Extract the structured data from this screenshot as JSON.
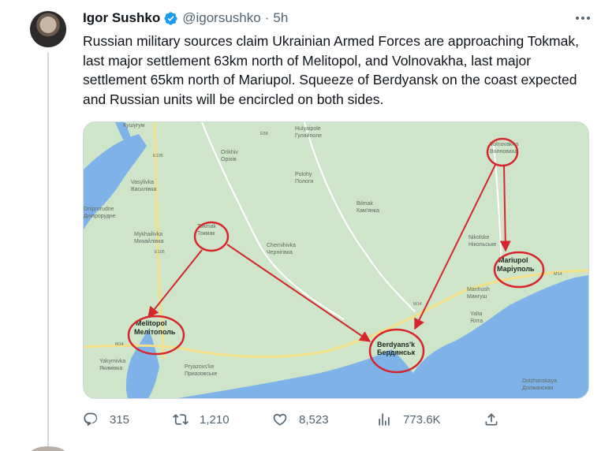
{
  "author": {
    "name": "Igor Sushko",
    "handle": "@igorsushko",
    "separator": "·",
    "time": "5h"
  },
  "tweet_text": "Russian military sources claim Ukrainian Armed Forces are approaching Tokmak, last major settlement 63km north of Melitopol, and Volnovakha, last major settlement 65km north of Mariupol. Squeeze of Berdyansk on the coast expected and Russian units will be encircled on both sides.",
  "map": {
    "places": {
      "kushuhum": "Кушугум",
      "hulyaipole_en": "Hulyaipole",
      "hulyaipole_ua": "Гуляйполе",
      "orikhiv_en": "Orikhiv",
      "orikhiv_ua": "Оріхів",
      "polohy_en": "Polohy",
      "polohy_ua": "Пологи",
      "vasylivka_en": "Vasylivka",
      "vasylivka_ua": "Василівка",
      "dniprorudne_en": "Dniprorudne",
      "dniprorudne_ua": "Дніпрорудне",
      "bilmak_en": "Bilmak",
      "bilmak_ua": "Кам'янка",
      "mykhailivka_en": "Mykhailivka",
      "mykhailivka_ua": "Михайлівка",
      "tokmak_en": "Tokmak",
      "tokmak_ua": "Токмак",
      "chernihivka_en": "Chernihivka",
      "chernihivka_ua": "Чернігівка",
      "volnovakha_en": "Volnovakha",
      "volnovakha_ua": "Волноваха",
      "nikolske_en": "Nikolske",
      "nikolske_ua": "Нікольське",
      "mariupol_en": "Mariupol",
      "mariupol_ua": "Маріуполь",
      "manhush_en": "Manhush",
      "manhush_ua": "Мангуш",
      "yalta_en": "Yalta",
      "yalta_ua": "Ялта",
      "melitopol_en": "Melitopol",
      "melitopol_ua": "Мелітополь",
      "berdyansk_en": "Berdyans'k",
      "berdyansk_ua": "Бердянськ",
      "yakymivka_en": "Yakymivka",
      "yakymivka_ua": "Якимівка",
      "pryazovske_en": "Pryazovs'ke",
      "pryazovske_ua": "Приазовське",
      "dolzhanskaya_en": "Dolzhanskaya",
      "dolzhanskaya_ua": "Должанская"
    },
    "roads": {
      "m14_a": "M14",
      "m14_b": "M14",
      "m14_c": "M14",
      "e105": "E105",
      "e58": "E58",
      "e105b": "E105"
    },
    "colors": {
      "land": "#cfe5c9",
      "water": "#7fb2e8",
      "circle": "#d6262b",
      "road": "#f3df87"
    }
  },
  "actions": {
    "replies": "315",
    "retweets": "1,210",
    "likes": "8,523",
    "views": "773.6K"
  },
  "icons": [
    "verified-badge-icon",
    "more-icon",
    "reply-icon",
    "retweet-icon",
    "like-icon",
    "views-icon",
    "share-icon"
  ]
}
